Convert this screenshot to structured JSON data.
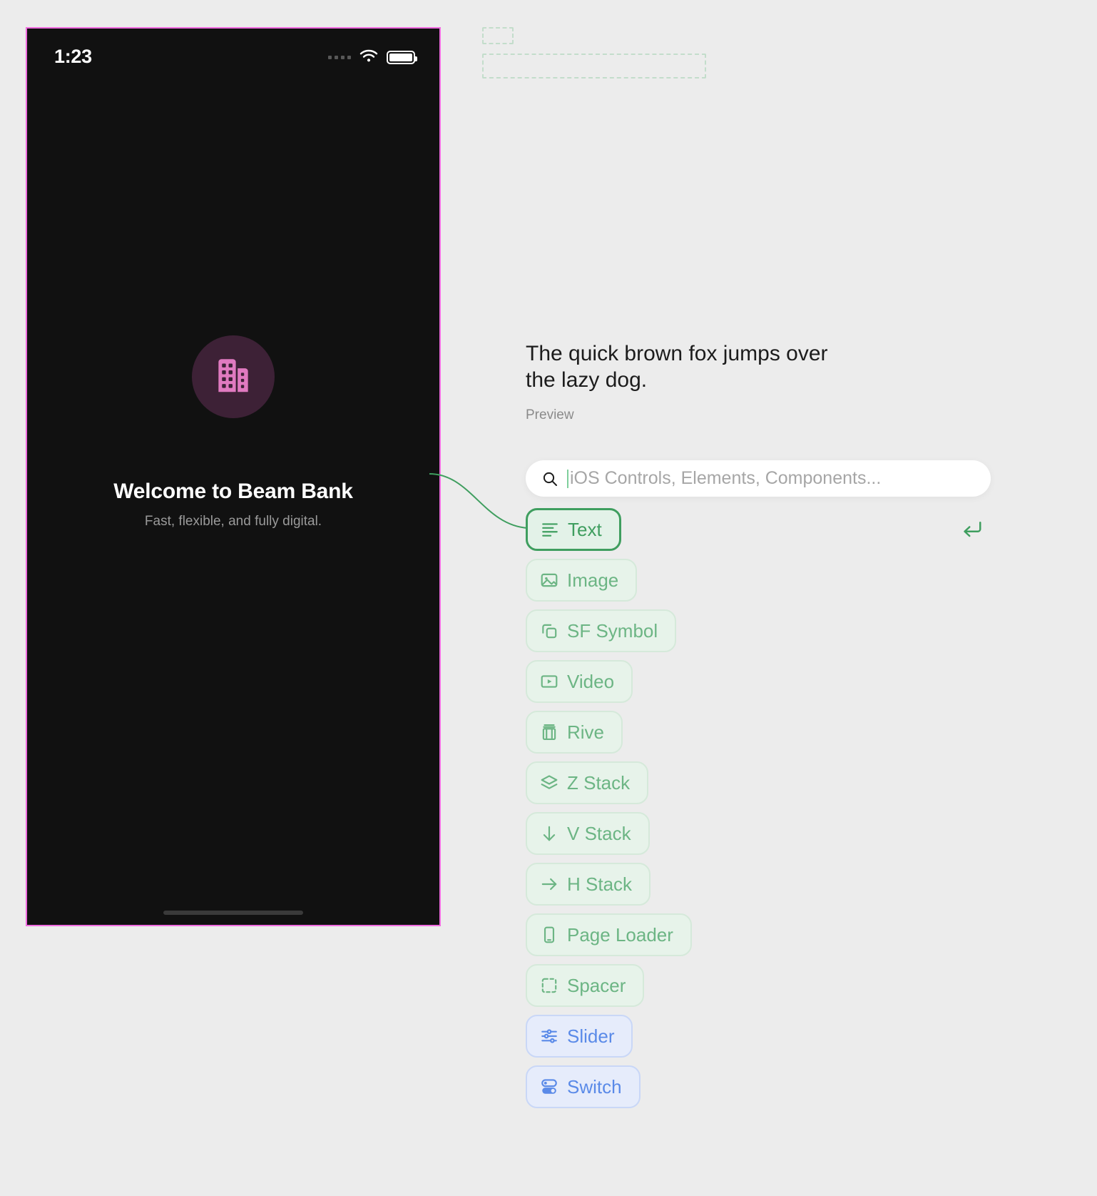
{
  "canvas": {
    "background": "#ececec",
    "accent_green": "#3f9e5f",
    "accent_blue": "#5a8ae8",
    "phone_border": "#f06ce0"
  },
  "placeholders": [
    {
      "name": "dashed-placeholder-small"
    },
    {
      "name": "dashed-placeholder-wide"
    }
  ],
  "phone": {
    "status_bar": {
      "time": "1:23",
      "icons": [
        "signal-dots-icon",
        "wifi-icon",
        "battery-icon"
      ]
    },
    "screen": {
      "brand_icon": "building-icon",
      "brand_icon_color": "#e07ac0",
      "brand_circle_color": "#3d2136",
      "title": "Welcome to Beam Bank",
      "subtitle": "Fast, flexible, and fully digital."
    }
  },
  "preview": {
    "text": "The quick brown fox jumps over the lazy dog.",
    "label": "Preview"
  },
  "search": {
    "placeholder": "iOS Controls, Elements, Components...",
    "value": "",
    "icon": "search-icon"
  },
  "enter_hint": {
    "icon": "return-arrow-icon",
    "glyph": "↵"
  },
  "chips": [
    {
      "label": "Text",
      "icon": "text-align-icon",
      "color": "green",
      "selected": true
    },
    {
      "label": "Image",
      "icon": "image-icon",
      "color": "green",
      "selected": false
    },
    {
      "label": "SF Symbol",
      "icon": "sf-symbol-icon",
      "color": "green",
      "selected": false
    },
    {
      "label": "Video",
      "icon": "video-icon",
      "color": "green",
      "selected": false
    },
    {
      "label": "Rive",
      "icon": "film-icon",
      "color": "green",
      "selected": false
    },
    {
      "label": "Z Stack",
      "icon": "layers-icon",
      "color": "green",
      "selected": false
    },
    {
      "label": "V Stack",
      "icon": "arrow-down-icon",
      "color": "green",
      "selected": false
    },
    {
      "label": "H Stack",
      "icon": "arrow-right-icon",
      "color": "green",
      "selected": false
    },
    {
      "label": "Page Loader",
      "icon": "phone-icon",
      "color": "green",
      "selected": false
    },
    {
      "label": "Spacer",
      "icon": "dashed-square-icon",
      "color": "green",
      "selected": false
    },
    {
      "label": "Slider",
      "icon": "sliders-icon",
      "color": "blue",
      "selected": false
    },
    {
      "label": "Switch",
      "icon": "toggle-icon",
      "color": "blue",
      "selected": false
    }
  ]
}
